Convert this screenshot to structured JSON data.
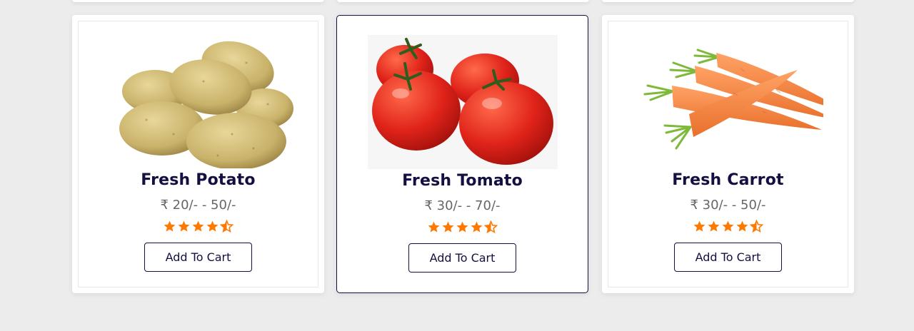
{
  "products": [
    {
      "name": "Fresh Potato",
      "price": "₹ 20/- - 50/-",
      "rating": 4.5,
      "button": "Add To Cart",
      "image_icon": "potato-image"
    },
    {
      "name": "Fresh Tomato",
      "price": "₹ 30/- - 70/-",
      "rating": 4.5,
      "button": "Add To Cart",
      "image_icon": "tomato-image"
    },
    {
      "name": "Fresh Carrot",
      "price": "₹ 30/- - 50/-",
      "rating": 4.5,
      "button": "Add To Cart",
      "image_icon": "carrot-image"
    }
  ],
  "colors": {
    "accent": "#130f40",
    "star": "#ff7800",
    "background": "#ececec"
  }
}
